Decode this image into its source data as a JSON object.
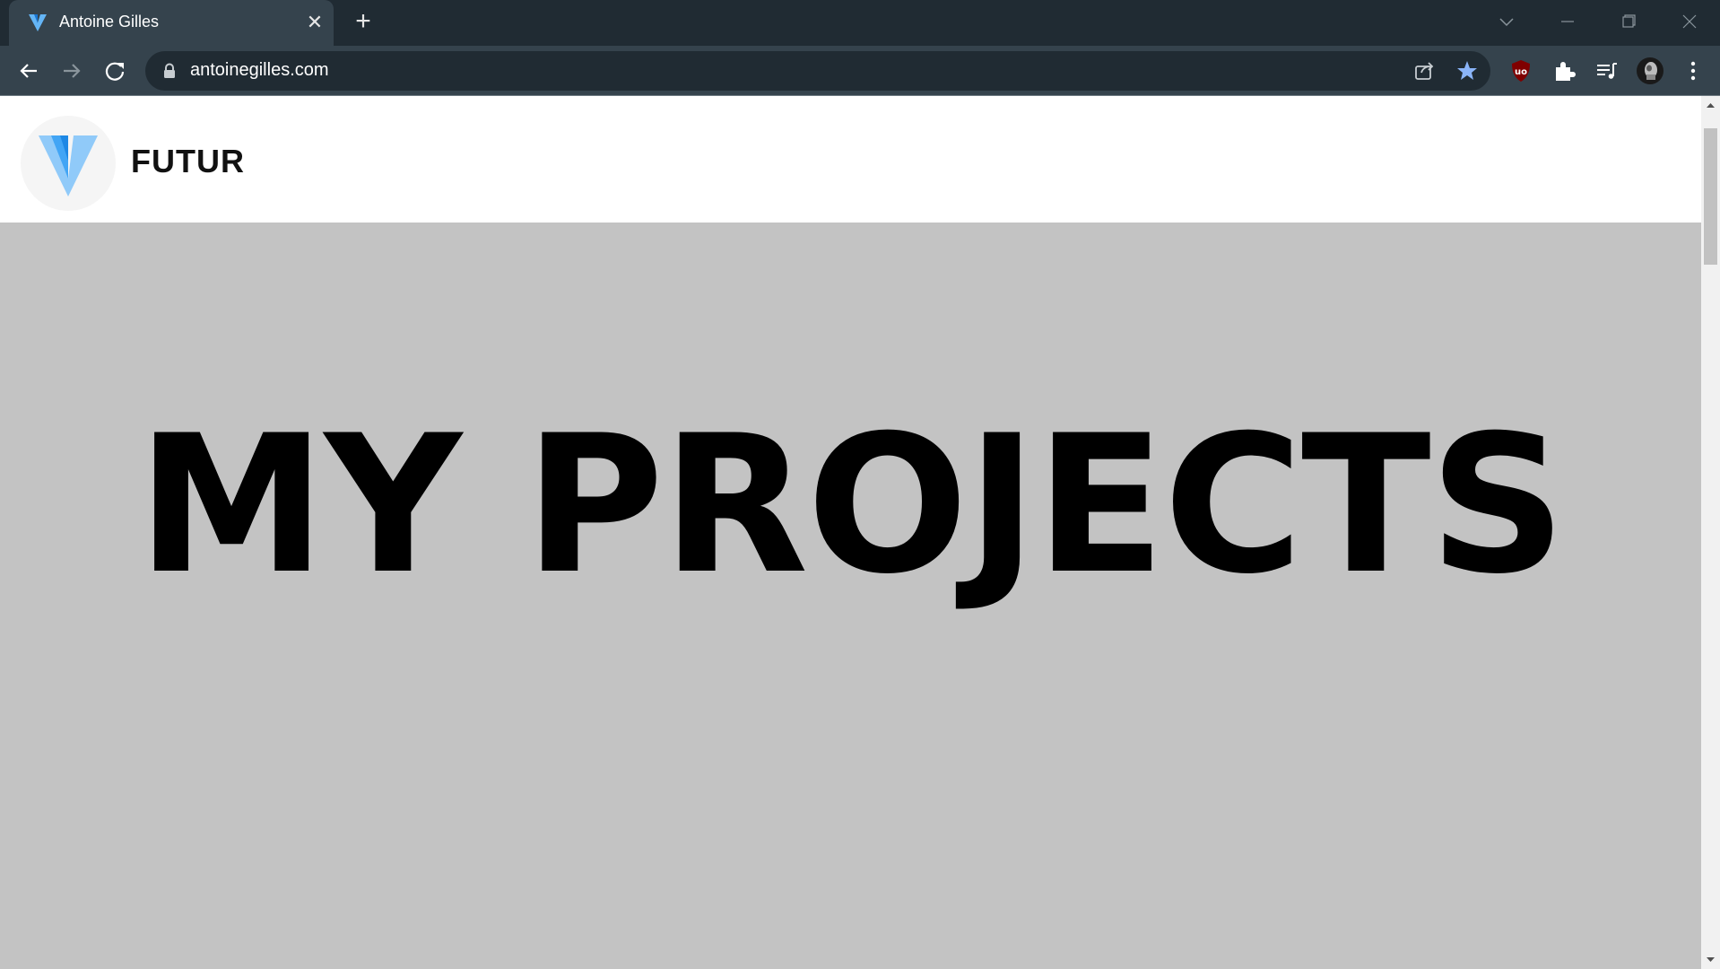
{
  "browser": {
    "tab": {
      "title": "Antoine Gilles",
      "close_symbol": "✕"
    },
    "new_tab_symbol": "+",
    "address_bar": {
      "url": "antoinegilles.com"
    },
    "icons": {
      "back": "back-arrow-icon",
      "forward": "forward-arrow-icon",
      "reload": "reload-icon",
      "lock": "lock-icon",
      "share": "share-icon",
      "bookmark": "star-icon",
      "ublock": "ublock-shield-icon",
      "extensions": "puzzle-icon",
      "media": "media-queue-icon",
      "profile": "avatar",
      "menu": "kebab-menu-icon"
    },
    "colors": {
      "tabstrip": "#202b33",
      "toolbar": "#35434d",
      "bookmark_star": "#8ab4f8",
      "ublock": "#800000"
    }
  },
  "site": {
    "brand": "FUTUR",
    "hero_title": "MY PROJECTS",
    "colors": {
      "header_bg": "#ffffff",
      "page_bg": "#c3c3c3",
      "title": "#000000",
      "logo_light": "#90caf9",
      "logo_dark": "#1e88e5"
    }
  }
}
